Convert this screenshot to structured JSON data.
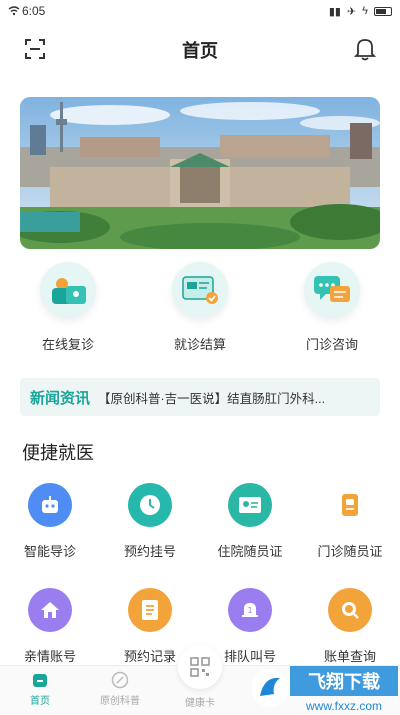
{
  "status_bar": {
    "time": "6:05",
    "carrier_icon": "wifi-icon"
  },
  "header": {
    "title": "首页",
    "scan_icon": "scan-icon",
    "bell_icon": "bell-icon"
  },
  "banner": {
    "image": "campus-aerial-photo"
  },
  "quick_services": [
    {
      "label": "在线复诊",
      "icon": "video-consult-icon"
    },
    {
      "label": "就诊结算",
      "icon": "bill-card-icon"
    },
    {
      "label": "门诊咨询",
      "icon": "chat-bubble-icon"
    }
  ],
  "news": {
    "tag": "新闻资讯",
    "text": "【原创科普·吉一医说】结直肠肛门外科..."
  },
  "section": {
    "title": "便捷就医"
  },
  "services_row1": [
    {
      "label": "智能导诊",
      "icon": "robot-icon",
      "color": "#4f8df5"
    },
    {
      "label": "预约挂号",
      "icon": "clock-icon",
      "color": "#26b8ad"
    },
    {
      "label": "住院随员证",
      "icon": "id-card-icon",
      "color": "#2ab7a6"
    },
    {
      "label": "门诊随员证",
      "icon": "badge-icon",
      "color": "#f2a43a"
    }
  ],
  "services_row2": [
    {
      "label": "亲情账号",
      "icon": "home-icon",
      "color": "#9a7ef0"
    },
    {
      "label": "预约记录",
      "icon": "list-icon",
      "color": "#f2a43a"
    },
    {
      "label": "排队叫号",
      "icon": "bell-queue-icon",
      "color": "#9a7ef0"
    },
    {
      "label": "账单查询",
      "icon": "search-icon",
      "color": "#f2a43a"
    }
  ],
  "tabs": [
    {
      "label": "首页",
      "icon": "home-tab-icon",
      "active": true
    },
    {
      "label": "原创科普",
      "icon": "compass-icon",
      "active": false
    },
    {
      "label": "健康卡",
      "icon": "qr-icon",
      "active": false
    }
  ],
  "watermark": {
    "text": "飞翔下载",
    "url": "www.fxxz.com"
  },
  "colors": {
    "accent": "#1aa59b",
    "news_bg": "#eef6f5"
  }
}
